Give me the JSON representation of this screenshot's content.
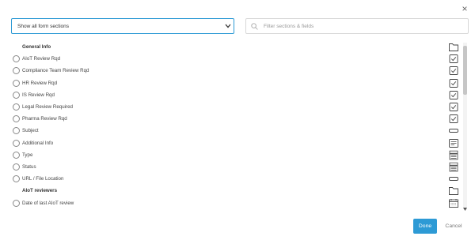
{
  "dialog": {
    "close_label": "×",
    "section_filter": {
      "selected": "Show all form sections"
    },
    "search": {
      "placeholder": "Filter sections & fields",
      "value": ""
    },
    "rows": [
      {
        "kind": "group",
        "label": "General Info",
        "icon": "folder-icon"
      },
      {
        "kind": "field",
        "label": "AIoT Review Rqd",
        "icon": "checkbox-icon"
      },
      {
        "kind": "field",
        "label": "Compliance Team Review Rqd",
        "icon": "checkbox-icon"
      },
      {
        "kind": "field",
        "label": "HR Review Rqd",
        "icon": "checkbox-icon"
      },
      {
        "kind": "field",
        "label": "IS Review Rqd",
        "icon": "checkbox-icon"
      },
      {
        "kind": "field",
        "label": "Legal Review Required",
        "icon": "checkbox-icon"
      },
      {
        "kind": "field",
        "label": "Pharma Review Rqd",
        "icon": "checkbox-icon"
      },
      {
        "kind": "field",
        "label": "Subject",
        "icon": "text-field-icon"
      },
      {
        "kind": "field",
        "label": "Additional Info",
        "icon": "textarea-icon"
      },
      {
        "kind": "field",
        "label": "Type",
        "icon": "dropdown-list-icon"
      },
      {
        "kind": "field",
        "label": "Status",
        "icon": "dropdown-list-icon"
      },
      {
        "kind": "field",
        "label": "URL / File Location",
        "icon": "text-field-icon"
      },
      {
        "kind": "group",
        "label": "AIoT reviewers",
        "icon": "folder-icon"
      },
      {
        "kind": "field",
        "label": "Date of last AIoT review",
        "icon": "calendar-icon"
      }
    ],
    "done_label": "Done",
    "cancel_label": "Cancel",
    "colors": {
      "accent": "#2d9ad5",
      "icon": "#444444"
    }
  }
}
